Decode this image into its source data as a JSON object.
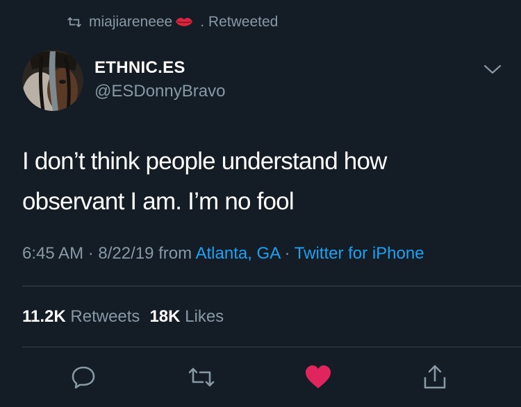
{
  "retweet_context": {
    "user": "miajiareneee",
    "suffix": ". Retweeted",
    "icons": [
      "retweet-icon",
      "lips-emoji"
    ]
  },
  "author": {
    "display_name": "ETHNIC.ES",
    "handle": "@ESDonnyBravo"
  },
  "tweet": {
    "text_line_1": "I don’t think people understand how",
    "text_line_2": "observant I am. I’m no fool"
  },
  "meta": {
    "time": "6:45 AM",
    "sep1": " · ",
    "date": "8/22/19",
    "from_label": " from ",
    "location": "Atlanta, GA",
    "sep2": " · ",
    "client": "Twitter for iPhone"
  },
  "stats": {
    "retweets_count": "11.2K",
    "retweets_label": "Retweets",
    "likes_count": "18K",
    "likes_label": "Likes"
  },
  "actions": [
    "reply-icon",
    "retweet-icon",
    "like-icon",
    "share-icon"
  ],
  "colors": {
    "background": "#141d26",
    "secondary_text": "#8899a6",
    "link": "#1da1f2",
    "like": "#e0245e",
    "divider": "#38444d"
  }
}
